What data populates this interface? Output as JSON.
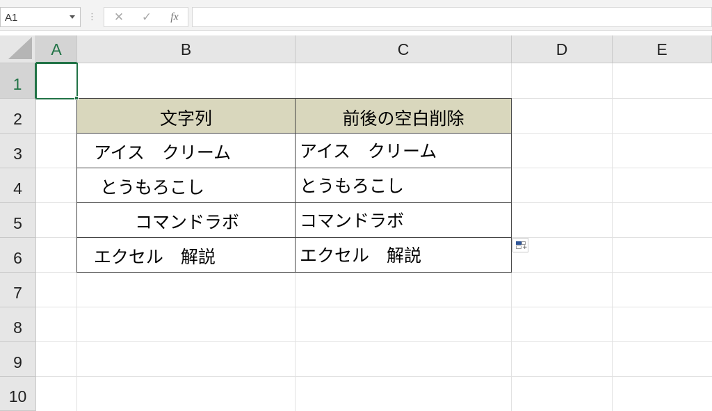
{
  "name_box": {
    "value": "A1"
  },
  "formula_bar": {
    "separator": "⋮",
    "cancel_glyph": "✕",
    "enter_glyph": "✓",
    "fx_label": "fx",
    "value": ""
  },
  "columns": [
    "A",
    "B",
    "C",
    "D",
    "E"
  ],
  "rows": [
    "1",
    "2",
    "3",
    "4",
    "5",
    "6",
    "7",
    "8",
    "9",
    "10"
  ],
  "active_cell": {
    "column": "A",
    "row": "1"
  },
  "table": {
    "headers": [
      "文字列",
      "前後の空白削除"
    ],
    "rows": [
      [
        "  アイス　クリーム　",
        "アイス　クリーム"
      ],
      [
        "　とうもろこし　",
        "とうもろこし"
      ],
      [
        "　　　コマンドラボ　",
        "コマンドラボ"
      ],
      [
        "  エクセル　解説　",
        "エクセル　解説"
      ]
    ]
  },
  "colors": {
    "header_fill": "#d9d7bd",
    "selection": "#217346",
    "gridline": "#e1e1e1"
  },
  "icons": [
    "chevron-down-icon",
    "cancel-icon",
    "enter-icon",
    "fx-icon",
    "quick-analysis-icon"
  ]
}
